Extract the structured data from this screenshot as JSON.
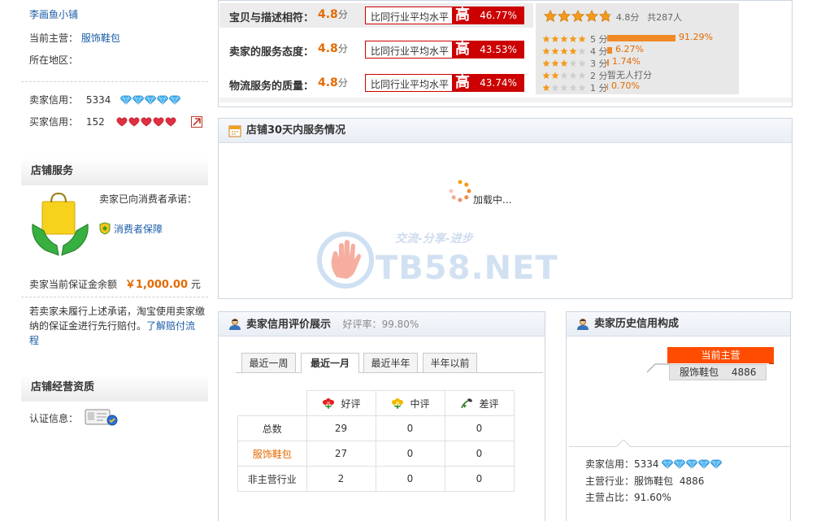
{
  "left": {
    "shop_name": "李画鱼小铺",
    "main_category_label": "当前主营：",
    "main_category": "服饰鞋包",
    "region_label": "所在地区：",
    "seller_credit_label": "卖家信用：",
    "seller_credit": "5334",
    "buyer_credit_label": "买家信用：",
    "buyer_credit": "152",
    "service_title": "店铺服务",
    "promise_text": "卖家已向消费者承诺：",
    "consumer_protection": "消费者保障",
    "deposit_label": "卖家当前保证金余额",
    "deposit_amount": "￥1,000.00",
    "deposit_unit": "元",
    "notice_text": "若卖家未履行上述承诺，淘宝使用卖家缴纳的保证金进行先行赔付。",
    "notice_link_1": "了解赔付流",
    "notice_link_2": "程",
    "qualification_title": "店铺经营资质",
    "cert_label": "认证信息："
  },
  "ratings": [
    {
      "label": "宝贝与描述相符：",
      "score": "4.8",
      "unit": "分",
      "compare_text": "比同行业平均水平",
      "level": "高",
      "percent": "46.77%"
    },
    {
      "label": "卖家的服务态度：",
      "score": "4.8",
      "unit": "分",
      "compare_text": "比同行业平均水平",
      "level": "高",
      "percent": "43.53%"
    },
    {
      "label": "物流服务的质量：",
      "score": "4.8",
      "unit": "分",
      "compare_text": "比同行业平均水平",
      "level": "高",
      "percent": "43.74%"
    }
  ],
  "distribution": {
    "overall_score": "4.8分",
    "total_people": "共287人",
    "overall_stars": 4.8,
    "rows": [
      {
        "stars": 5,
        "label": "5 分",
        "percent_text": "91.29%",
        "fraction": 0.9129
      },
      {
        "stars": 4,
        "label": "4 分",
        "percent_text": "6.27%",
        "fraction": 0.0627
      },
      {
        "stars": 3,
        "label": "3 分",
        "percent_text": "1.74%",
        "fraction": 0.0174
      },
      {
        "stars": 2,
        "label": "2 分",
        "percent_text": "暂无人打分",
        "fraction": 0
      },
      {
        "stars": 1,
        "label": "1 分",
        "percent_text": "0.70%",
        "fraction": 0.007
      }
    ]
  },
  "service30": {
    "title": "店铺30天内服务情况",
    "loading": "加载中..."
  },
  "watermark": {
    "text": "TB58.NET",
    "slogan": "交流-分享-进步"
  },
  "credit_display": {
    "title": "卖家信用评价展示",
    "good_rate_label": "好评率：",
    "good_rate": "99.80%",
    "tabs": [
      "最近一周",
      "最近一月",
      "最近半年",
      "半年以前"
    ],
    "active_tab": 1,
    "columns": [
      "好评",
      "中评",
      "差评"
    ],
    "rows": [
      {
        "label": "总数",
        "values": [
          "29",
          "0",
          "0"
        ]
      },
      {
        "label": "服饰鞋包",
        "values": [
          "27",
          "0",
          "0"
        ]
      },
      {
        "label": "非主营行业",
        "values": [
          "2",
          "0",
          "0"
        ]
      }
    ]
  },
  "history": {
    "title": "卖家历史信用构成",
    "tag_label": "当前主营",
    "category": "服饰鞋包",
    "category_count": "4886",
    "seller_credit_label": "卖家信用：",
    "seller_credit": "5334",
    "main_industry_label": "主营行业：",
    "main_industry": "服饰鞋包",
    "main_industry_count": "4886",
    "share_label": "主营占比：",
    "share": "91.60%"
  },
  "colors": {
    "accent_orange": "#e46a00",
    "red": "#cc0000",
    "link_blue": "#1a5ca8",
    "tag_orange": "#ff4c00"
  }
}
